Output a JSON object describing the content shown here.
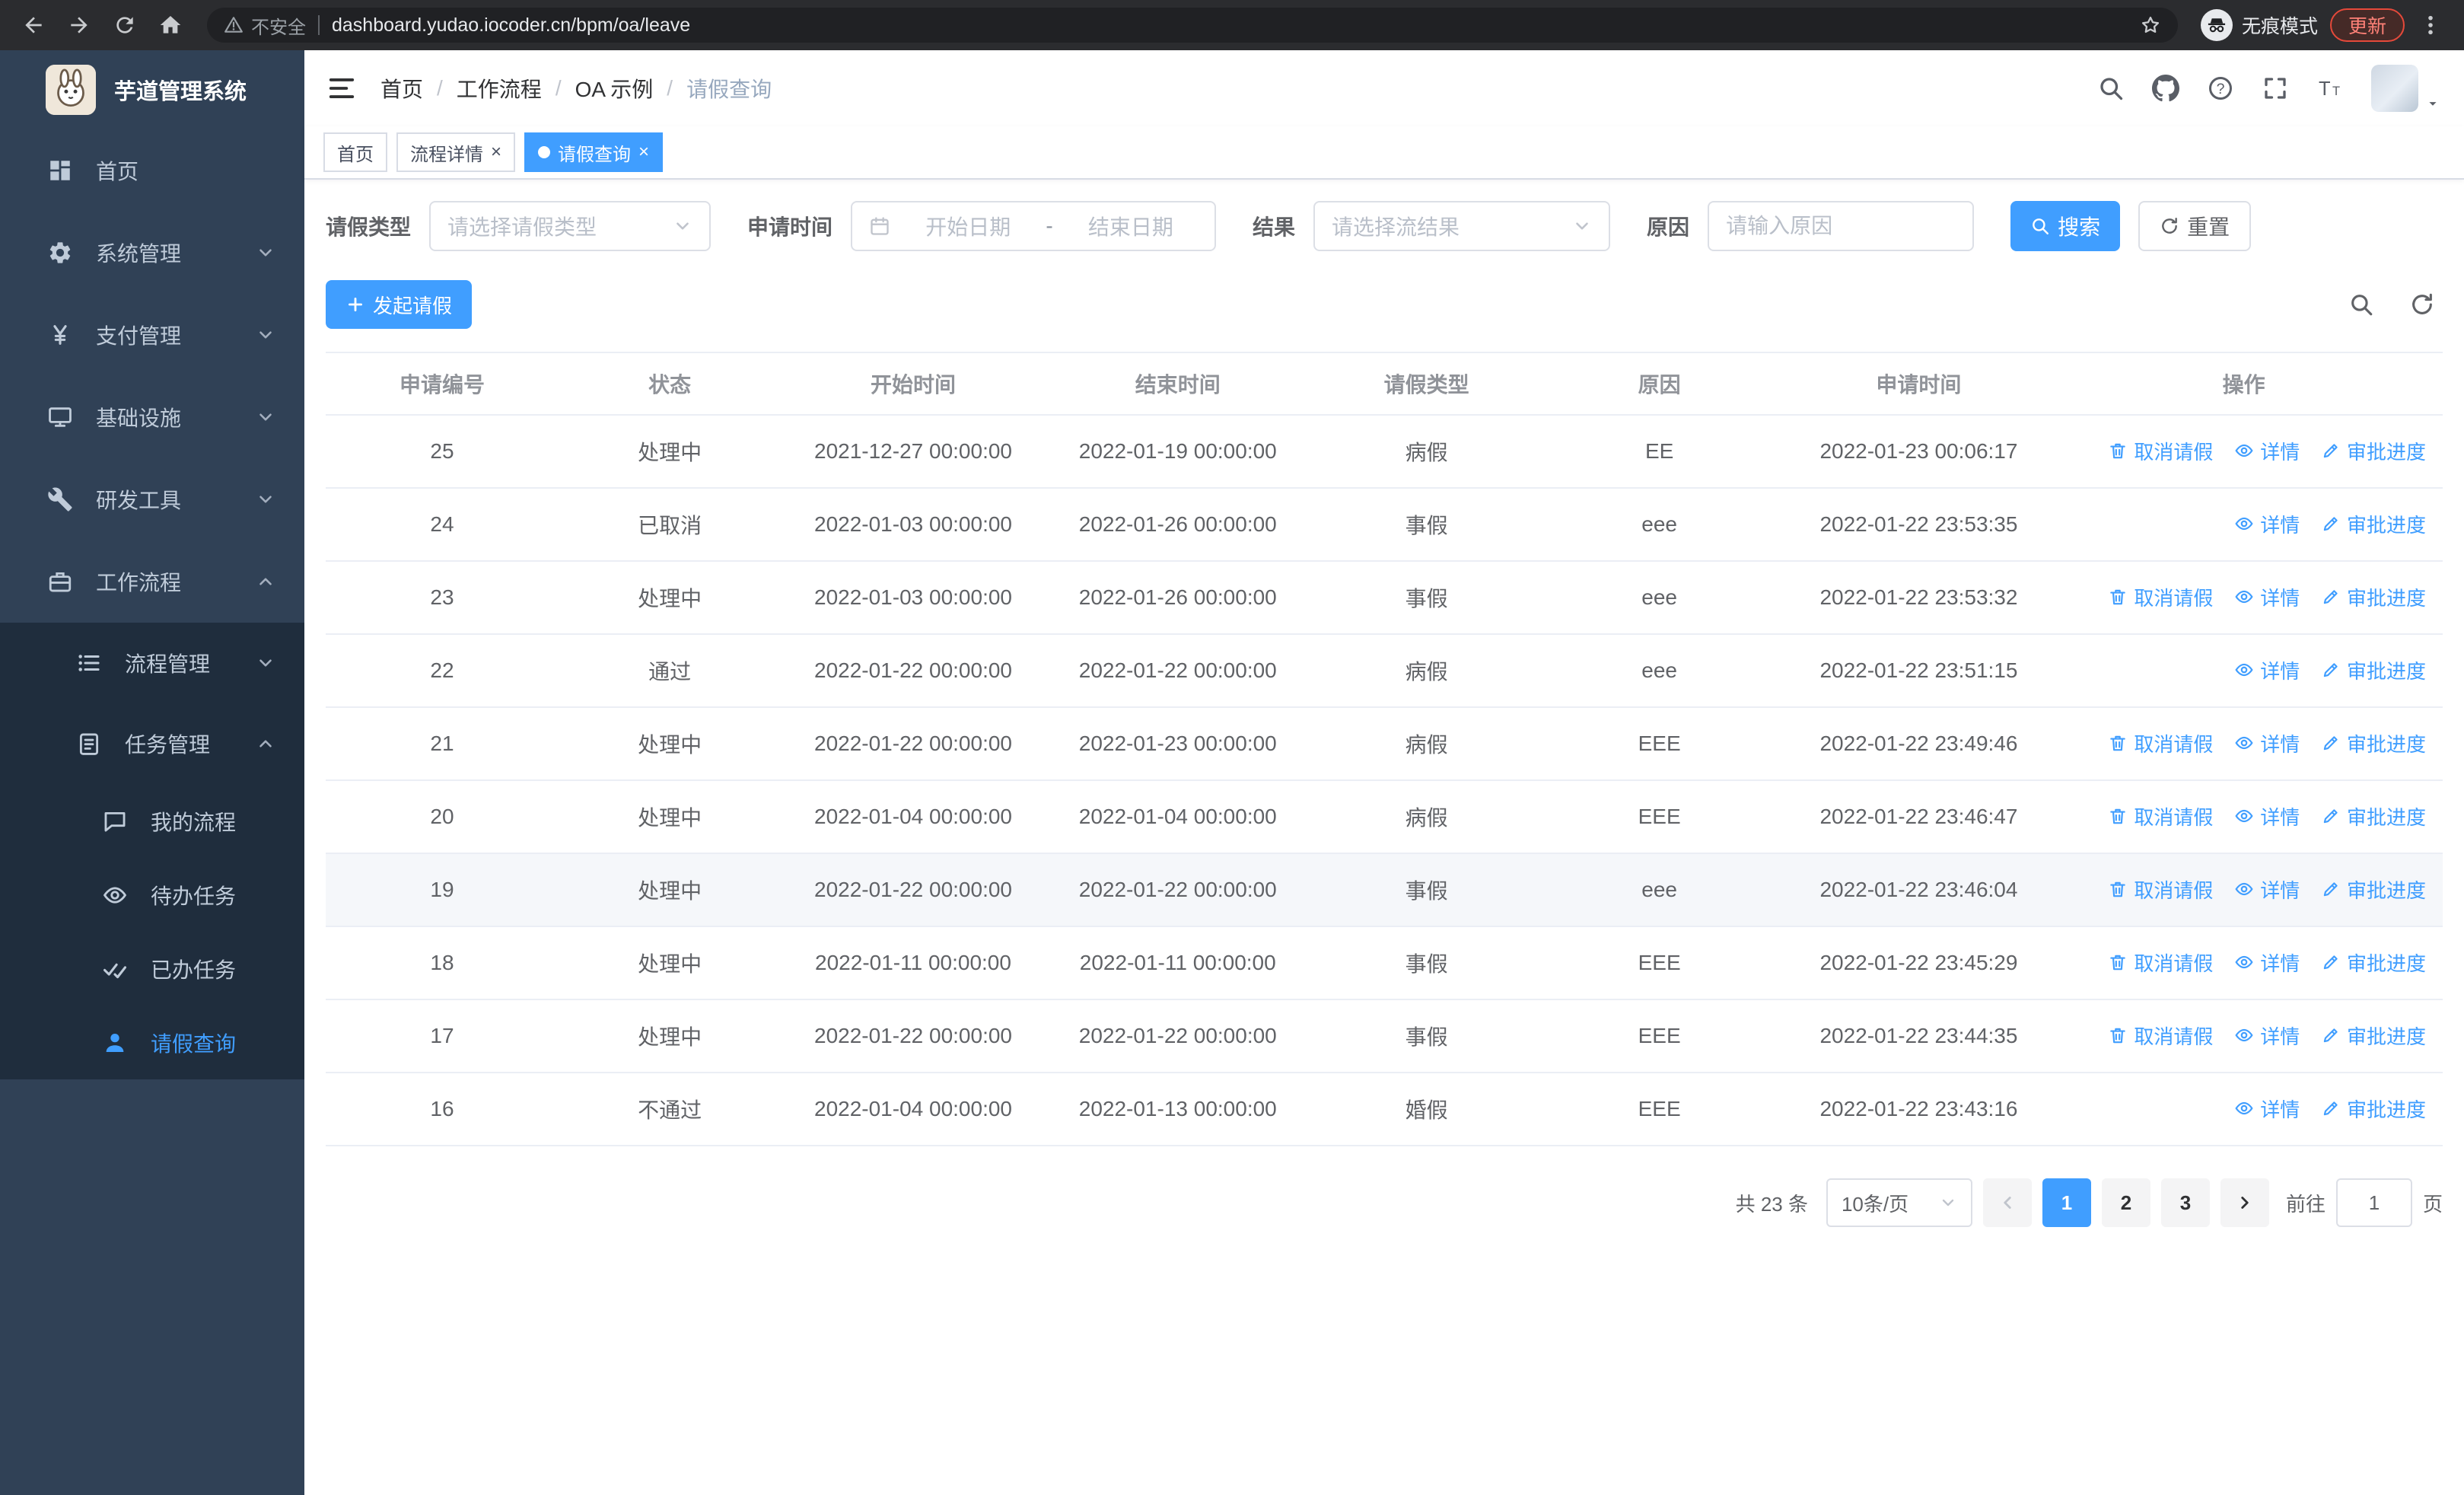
{
  "browser": {
    "security_label": "不安全",
    "url": "dashboard.yudao.iocoder.cn/bpm/oa/leave",
    "incognito_label": "无痕模式",
    "update_label": "更新"
  },
  "sidebar": {
    "logo_title": "芋道管理系统",
    "items": [
      {
        "label": "首页"
      },
      {
        "label": "系统管理"
      },
      {
        "label": "支付管理"
      },
      {
        "label": "基础设施"
      },
      {
        "label": "研发工具"
      },
      {
        "label": "工作流程"
      }
    ],
    "submenu": [
      {
        "label": "流程管理"
      },
      {
        "label": "任务管理"
      }
    ],
    "task_items": [
      {
        "label": "我的流程"
      },
      {
        "label": "待办任务"
      },
      {
        "label": "已办任务"
      },
      {
        "label": "请假查询"
      }
    ]
  },
  "header": {
    "breadcrumb": [
      "首页",
      "工作流程",
      "OA 示例",
      "请假查询"
    ],
    "separator": "/"
  },
  "tabs": [
    {
      "label": "首页"
    },
    {
      "label": "流程详情"
    },
    {
      "label": "请假查询"
    }
  ],
  "glyphs": {
    "close": "×"
  },
  "filters": {
    "leave_type_label": "请假类型",
    "leave_type_placeholder": "请选择请假类型",
    "apply_time_label": "申请时间",
    "start_date_placeholder": "开始日期",
    "range_separator": "-",
    "end_date_placeholder": "结束日期",
    "result_label": "结果",
    "result_placeholder": "请选择流结果",
    "reason_label": "原因",
    "reason_placeholder": "请输入原因",
    "search_label": "搜索",
    "reset_label": "重置"
  },
  "toolbar": {
    "create_label": "发起请假"
  },
  "table": {
    "headers": [
      "申请编号",
      "状态",
      "开始时间",
      "结束时间",
      "请假类型",
      "原因",
      "申请时间",
      "操作"
    ],
    "actions": {
      "cancel": "取消请假",
      "detail": "详情",
      "progress": "审批进度"
    },
    "rows": [
      {
        "id": "25",
        "status": "处理中",
        "start": "2021-12-27 00:00:00",
        "end": "2022-01-19 00:00:00",
        "type": "病假",
        "reason": "EE",
        "applied": "2022-01-23 00:06:17",
        "cancellable": true,
        "highlight": false
      },
      {
        "id": "24",
        "status": "已取消",
        "start": "2022-01-03 00:00:00",
        "end": "2022-01-26 00:00:00",
        "type": "事假",
        "reason": "eee",
        "applied": "2022-01-22 23:53:35",
        "cancellable": false,
        "highlight": false
      },
      {
        "id": "23",
        "status": "处理中",
        "start": "2022-01-03 00:00:00",
        "end": "2022-01-26 00:00:00",
        "type": "事假",
        "reason": "eee",
        "applied": "2022-01-22 23:53:32",
        "cancellable": true,
        "highlight": false
      },
      {
        "id": "22",
        "status": "通过",
        "start": "2022-01-22 00:00:00",
        "end": "2022-01-22 00:00:00",
        "type": "病假",
        "reason": "eee",
        "applied": "2022-01-22 23:51:15",
        "cancellable": false,
        "highlight": false
      },
      {
        "id": "21",
        "status": "处理中",
        "start": "2022-01-22 00:00:00",
        "end": "2022-01-23 00:00:00",
        "type": "病假",
        "reason": "EEE",
        "applied": "2022-01-22 23:49:46",
        "cancellable": true,
        "highlight": false
      },
      {
        "id": "20",
        "status": "处理中",
        "start": "2022-01-04 00:00:00",
        "end": "2022-01-04 00:00:00",
        "type": "病假",
        "reason": "EEE",
        "applied": "2022-01-22 23:46:47",
        "cancellable": true,
        "highlight": false
      },
      {
        "id": "19",
        "status": "处理中",
        "start": "2022-01-22 00:00:00",
        "end": "2022-01-22 00:00:00",
        "type": "事假",
        "reason": "eee",
        "applied": "2022-01-22 23:46:04",
        "cancellable": true,
        "highlight": true
      },
      {
        "id": "18",
        "status": "处理中",
        "start": "2022-01-11 00:00:00",
        "end": "2022-01-11 00:00:00",
        "type": "事假",
        "reason": "EEE",
        "applied": "2022-01-22 23:45:29",
        "cancellable": true,
        "highlight": false
      },
      {
        "id": "17",
        "status": "处理中",
        "start": "2022-01-22 00:00:00",
        "end": "2022-01-22 00:00:00",
        "type": "事假",
        "reason": "EEE",
        "applied": "2022-01-22 23:44:35",
        "cancellable": true,
        "highlight": false
      },
      {
        "id": "16",
        "status": "不通过",
        "start": "2022-01-04 00:00:00",
        "end": "2022-01-13 00:00:00",
        "type": "婚假",
        "reason": "EEE",
        "applied": "2022-01-22 23:43:16",
        "cancellable": false,
        "highlight": false
      }
    ]
  },
  "pagination": {
    "total_label": "共 23 条",
    "page_size_value": "10条/页",
    "pages": [
      "1",
      "2",
      "3"
    ],
    "active_page": "1",
    "goto_label": "前往",
    "goto_value": "1",
    "goto_suffix": "页"
  },
  "colors": {
    "accent": "#409eff",
    "sidebar_bg": "#304156",
    "submenu_bg": "#1f2d3d"
  }
}
